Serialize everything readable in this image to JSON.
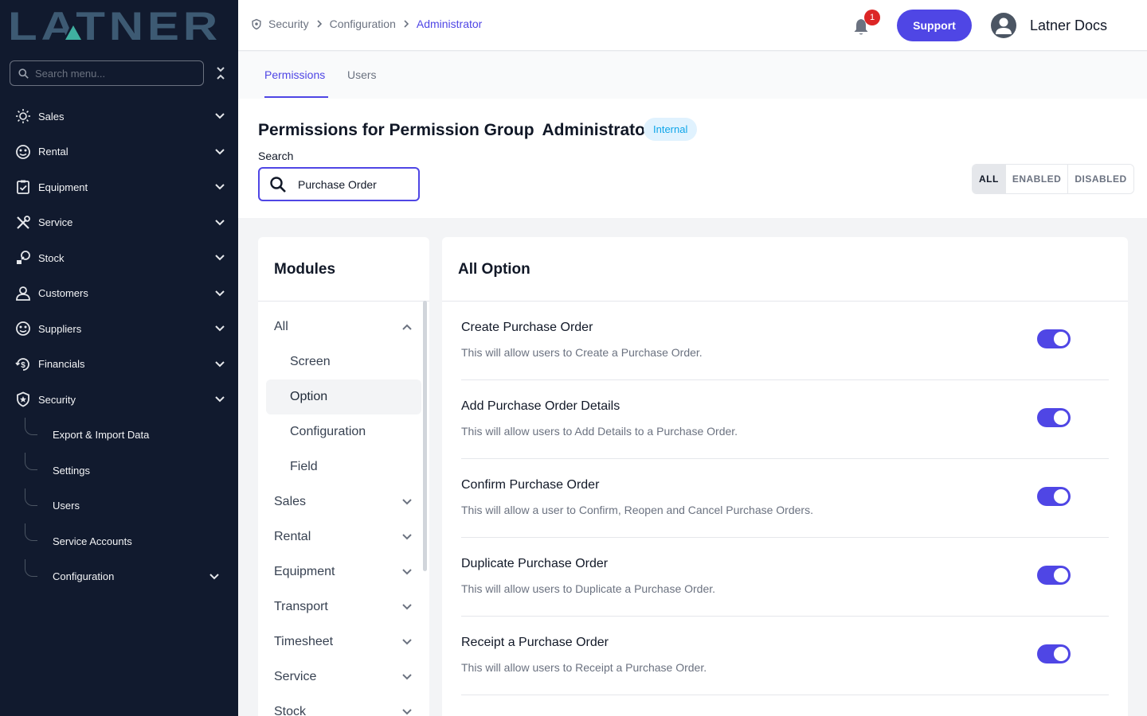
{
  "brand": {
    "logo_text": "LATNER",
    "logo_color": "#3d5a73",
    "logo_accent": "#3fb0a0"
  },
  "sidebar": {
    "search_placeholder": "Search menu...",
    "items": [
      {
        "label": "Sales",
        "icon": "sun-icon"
      },
      {
        "label": "Rental",
        "icon": "face-icon"
      },
      {
        "label": "Equipment",
        "icon": "clipboard-icon"
      },
      {
        "label": "Service",
        "icon": "tools-icon"
      },
      {
        "label": "Stock",
        "icon": "stock-icon"
      },
      {
        "label": "Customers",
        "icon": "user-icon"
      },
      {
        "label": "Suppliers",
        "icon": "face-icon"
      },
      {
        "label": "Financials",
        "icon": "dollar-icon"
      },
      {
        "label": "Security",
        "icon": "shield-icon"
      }
    ],
    "security_subitems": [
      {
        "label": "Export & Import Data"
      },
      {
        "label": "Settings"
      },
      {
        "label": "Users"
      },
      {
        "label": "Service Accounts"
      },
      {
        "label": "Configuration"
      }
    ]
  },
  "header": {
    "breadcrumb": [
      "Security",
      "Configuration",
      "Administrator"
    ],
    "notification_count": "1",
    "support_label": "Support",
    "user_name": "Latner Docs"
  },
  "tabs": [
    {
      "label": "Permissions",
      "active": true
    },
    {
      "label": "Users",
      "active": false
    }
  ],
  "page": {
    "title_prefix": "Permissions for Permission Group",
    "group_name": "Administrator",
    "tag": "Internal",
    "search_label": "Search",
    "search_value": "Purchase Order",
    "filters": [
      "ALL",
      "ENABLED",
      "DISABLED"
    ],
    "active_filter": "ALL"
  },
  "modules": {
    "title": "Modules",
    "items": [
      {
        "label": "All",
        "expanded": true
      },
      {
        "label": "Screen",
        "sub": true
      },
      {
        "label": "Option",
        "sub": true,
        "selected": true
      },
      {
        "label": "Configuration",
        "sub": true
      },
      {
        "label": "Field",
        "sub": true
      },
      {
        "label": "Sales"
      },
      {
        "label": "Rental"
      },
      {
        "label": "Equipment"
      },
      {
        "label": "Transport"
      },
      {
        "label": "Timesheet"
      },
      {
        "label": "Service"
      },
      {
        "label": "Stock"
      }
    ]
  },
  "options": {
    "title": "All Option",
    "rows": [
      {
        "name": "Create Purchase Order",
        "desc": "This will allow users to Create a Purchase Order.",
        "enabled": true
      },
      {
        "name": "Add Purchase Order Details",
        "desc": "This will allow users to Add Details to a Purchase Order.",
        "enabled": true
      },
      {
        "name": "Confirm Purchase Order",
        "desc": "This will allow a user to Confirm, Reopen and Cancel Purchase Orders.",
        "enabled": true
      },
      {
        "name": "Duplicate Purchase Order",
        "desc": "This will allow users to Duplicate a Purchase Order.",
        "enabled": true
      },
      {
        "name": "Receipt a Purchase Order",
        "desc": "This will allow users to Receipt a Purchase Order.",
        "enabled": true
      }
    ]
  },
  "colors": {
    "accent": "#4f46e5",
    "sidebar_bg": "#111a2e",
    "badge": "#dc2626",
    "tag_bg": "#e0f2fe",
    "tag_text": "#0ea5e9"
  }
}
